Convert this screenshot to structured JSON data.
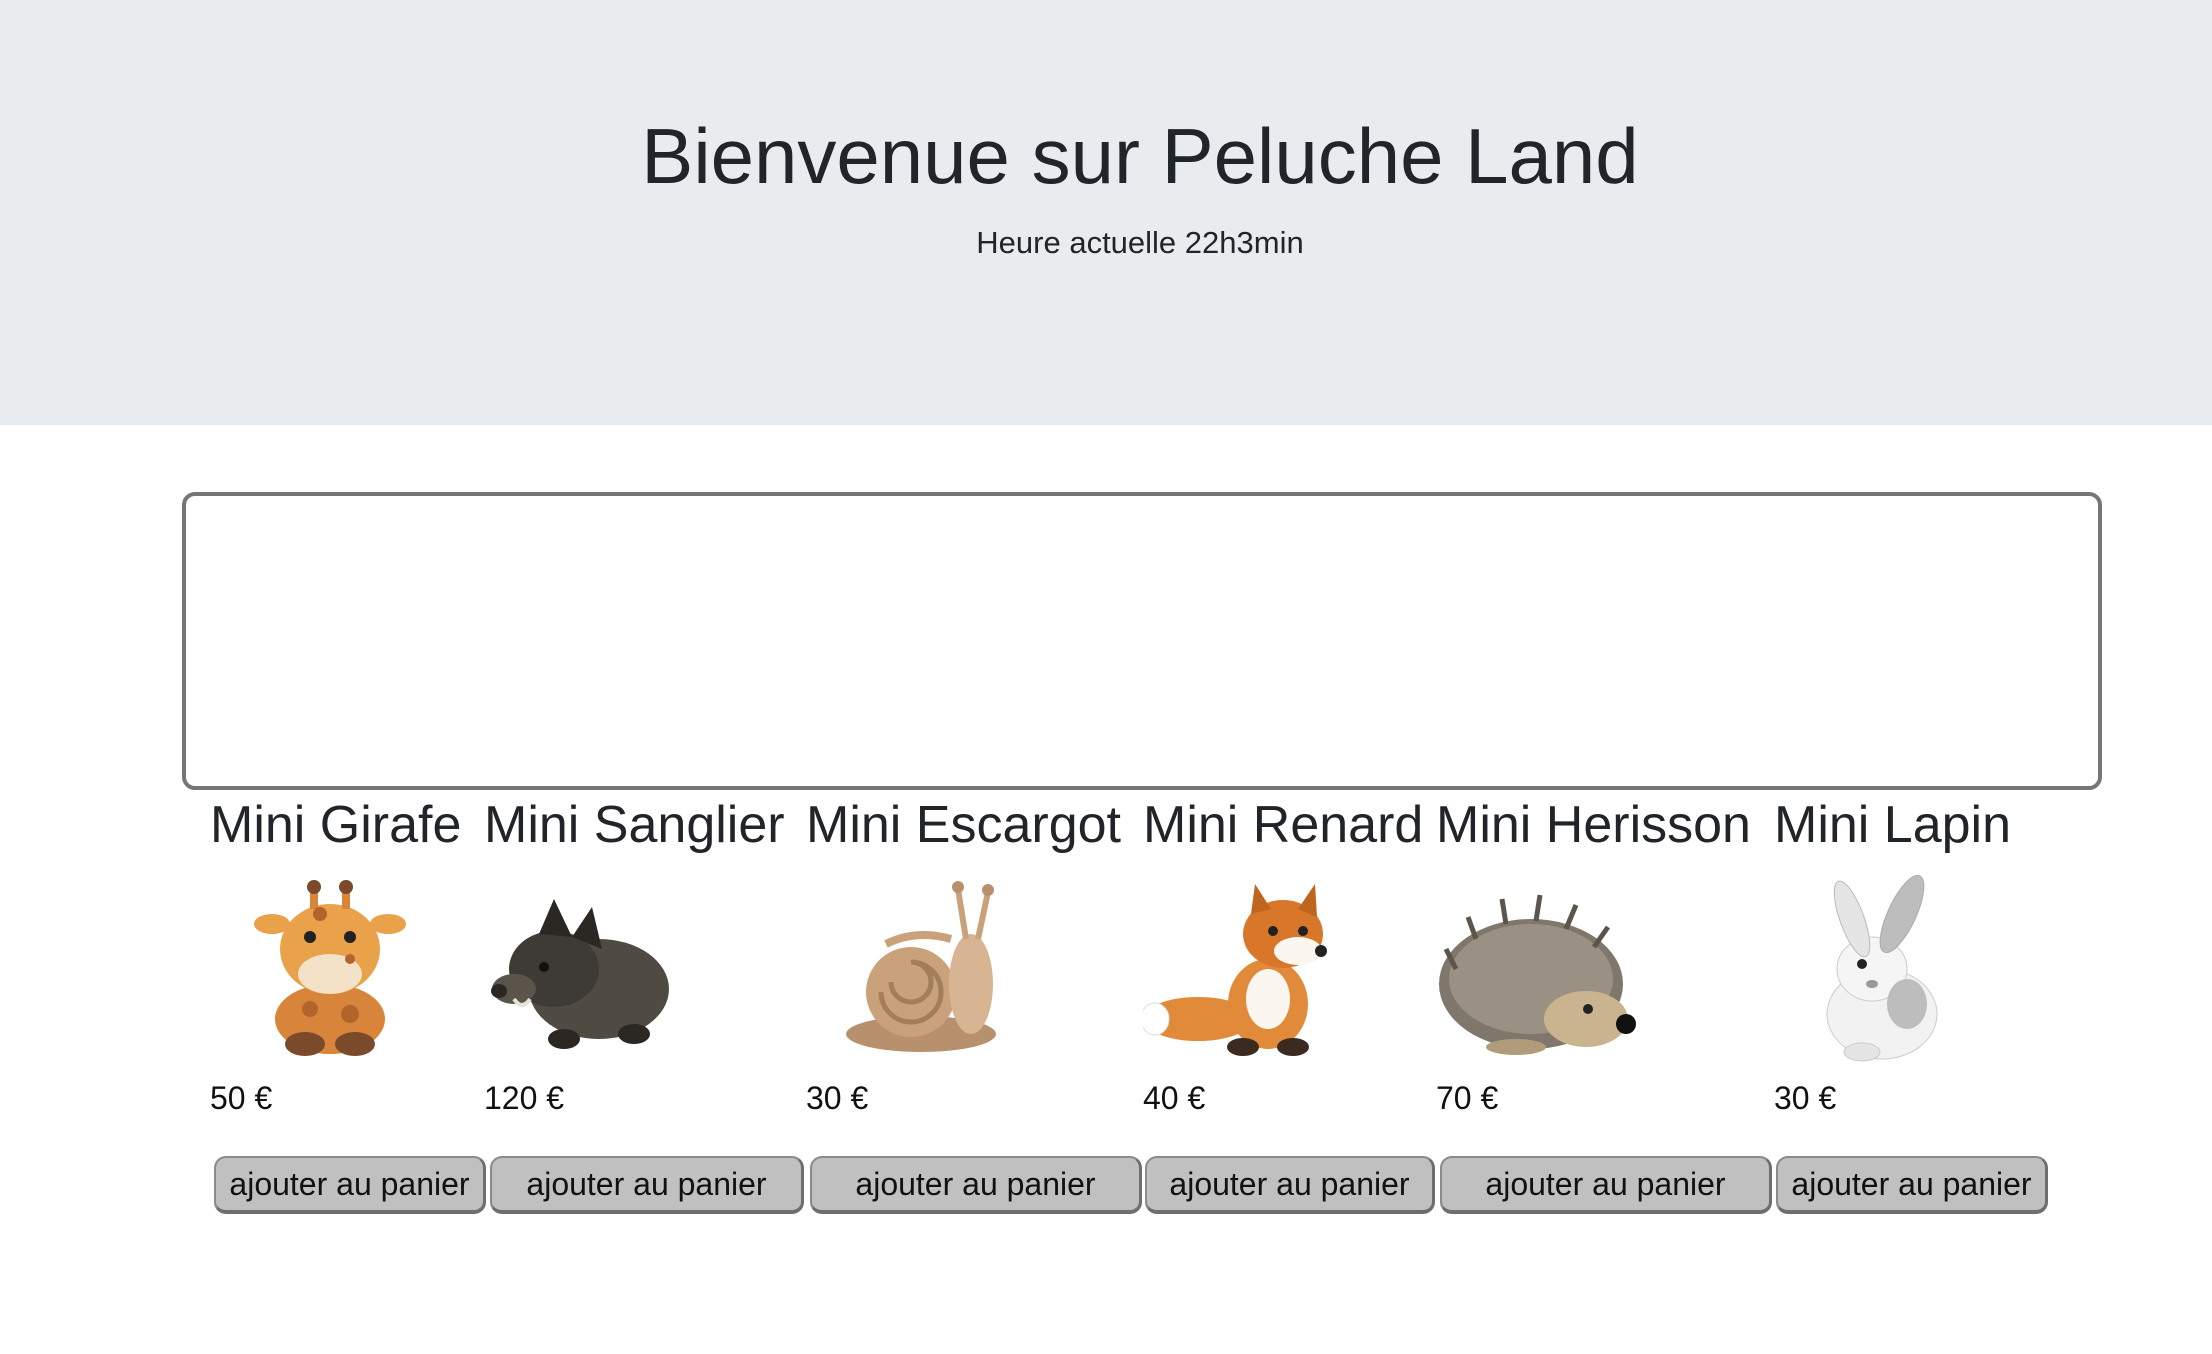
{
  "header": {
    "title": "Bienvenue sur Peluche Land",
    "subtitle": "Heure actuelle 22h3min"
  },
  "products": [
    {
      "name": "Mini Girafe",
      "price": "50 €",
      "button": "ajouter au panier",
      "icon": "giraffe-plush-icon"
    },
    {
      "name": "Mini Sanglier",
      "price": "120 €",
      "button": "ajouter au panier",
      "icon": "boar-plush-icon"
    },
    {
      "name": "Mini Escargot",
      "price": "30 €",
      "button": "ajouter au panier",
      "icon": "snail-plush-icon"
    },
    {
      "name": "Mini Renard",
      "price": "40 €",
      "button": "ajouter au panier",
      "icon": "fox-plush-icon"
    },
    {
      "name": "Mini Herisson",
      "price": "70 €",
      "button": "ajouter au panier",
      "icon": "hedgehog-plush-icon"
    },
    {
      "name": "Mini Lapin",
      "price": "30 €",
      "button": "ajouter au panier",
      "icon": "rabbit-plush-icon"
    }
  ]
}
